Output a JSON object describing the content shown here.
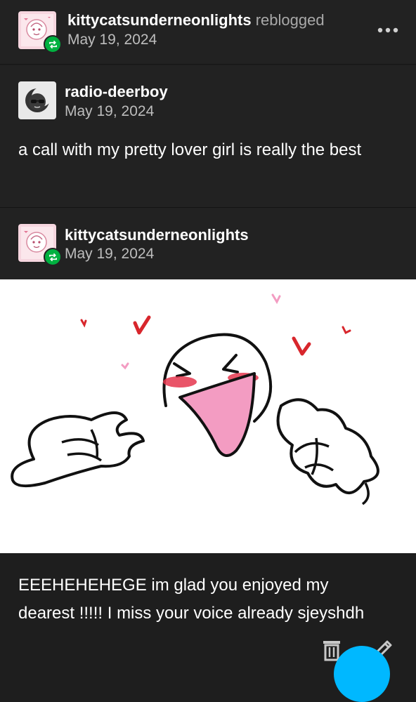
{
  "reblogger": {
    "username": "kittycatsunderneonlights",
    "action_text": "reblogged",
    "date": "May 19, 2024"
  },
  "trail": [
    {
      "username": "radio-deerboy",
      "date": "May 19, 2024",
      "text": "a call with my pretty lover girl is really the best"
    },
    {
      "username": "kittycatsunderneonlights",
      "date": "May 19, 2024"
    }
  ],
  "comment": {
    "line1": "EEEHEHEHEGE im glad you enjoyed my",
    "line2": "dearest !!!!! I miss your voice already sjeyshdh"
  },
  "icons": {
    "more": "more-horizontal-icon",
    "reblog_badge": "reblog-icon",
    "delete": "trash-icon",
    "edit": "pencil-icon"
  },
  "colors": {
    "background": "#222222",
    "reblog_green": "#00b140",
    "fab_blue": "#00b8ff",
    "heart_red": "#d8262c",
    "blush_pink": "#f39cc2"
  }
}
